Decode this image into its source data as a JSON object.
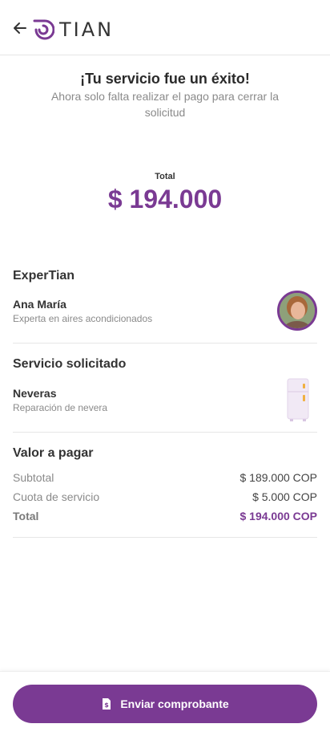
{
  "header": {
    "back_icon": "arrow-left-icon",
    "logo_text": "TIAN",
    "brand_color": "#7a3a93"
  },
  "hero": {
    "title": "¡Tu servicio fue un éxito!",
    "subtitle": "Ahora solo falta realizar el pago para cerrar la solicitud",
    "total_label": "Total",
    "total_amount": "$ 194.000"
  },
  "expert": {
    "section_title": "ExperTian",
    "name": "Ana María",
    "description": "Experta en aires acondicionados"
  },
  "service": {
    "section_title": "Servicio solicitado",
    "name": "Neveras",
    "description": "Reparación de nevera"
  },
  "payment": {
    "section_title": "Valor a pagar",
    "rows": [
      {
        "label": "Subtotal",
        "value": "$ 189.000 COP"
      },
      {
        "label": "Cuota de servicio",
        "value": "$ 5.000 COP"
      },
      {
        "label": "Total",
        "value": "$ 194.000 COP"
      }
    ]
  },
  "cta": {
    "label": "Enviar comprobante",
    "icon": "receipt-icon"
  }
}
